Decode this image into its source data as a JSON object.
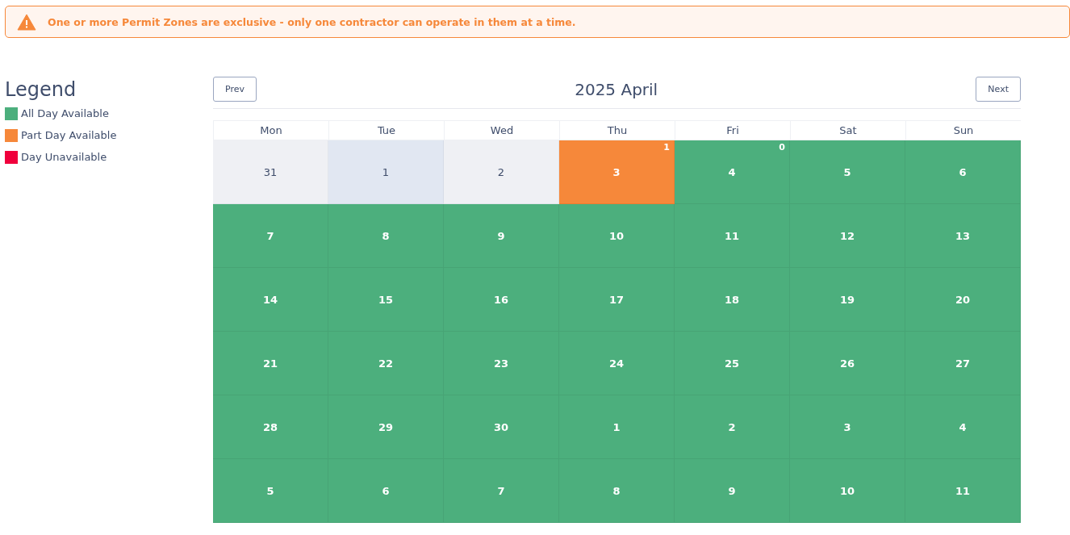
{
  "alert": {
    "text": "One or more Permit Zones are exclusive - only one contractor can operate in them at a time."
  },
  "legend": {
    "title": "Legend",
    "items": [
      {
        "label": "All Day Available",
        "color": "#4caf7d"
      },
      {
        "label": "Part Day Available",
        "color": "#f6883a"
      },
      {
        "label": "Day Unavailable",
        "color": "#f0003c"
      }
    ]
  },
  "calendar": {
    "title": "2025 April",
    "prev": "Prev",
    "next": "Next",
    "weekdays": [
      "Mon",
      "Tue",
      "Wed",
      "Thu",
      "Fri",
      "Sat",
      "Sun"
    ],
    "weeks": [
      [
        {
          "day": "31",
          "kind": "past"
        },
        {
          "day": "1",
          "kind": "today"
        },
        {
          "day": "2",
          "kind": "past"
        },
        {
          "day": "3",
          "kind": "part",
          "count": "1"
        },
        {
          "day": "4",
          "kind": "all",
          "count": "0"
        },
        {
          "day": "5",
          "kind": "all"
        },
        {
          "day": "6",
          "kind": "all"
        }
      ],
      [
        {
          "day": "7",
          "kind": "all"
        },
        {
          "day": "8",
          "kind": "all"
        },
        {
          "day": "9",
          "kind": "all"
        },
        {
          "day": "10",
          "kind": "all"
        },
        {
          "day": "11",
          "kind": "all"
        },
        {
          "day": "12",
          "kind": "all"
        },
        {
          "day": "13",
          "kind": "all"
        }
      ],
      [
        {
          "day": "14",
          "kind": "all"
        },
        {
          "day": "15",
          "kind": "all"
        },
        {
          "day": "16",
          "kind": "all"
        },
        {
          "day": "17",
          "kind": "all"
        },
        {
          "day": "18",
          "kind": "all"
        },
        {
          "day": "19",
          "kind": "all"
        },
        {
          "day": "20",
          "kind": "all"
        }
      ],
      [
        {
          "day": "21",
          "kind": "all"
        },
        {
          "day": "22",
          "kind": "all"
        },
        {
          "day": "23",
          "kind": "all"
        },
        {
          "day": "24",
          "kind": "all"
        },
        {
          "day": "25",
          "kind": "all"
        },
        {
          "day": "26",
          "kind": "all"
        },
        {
          "day": "27",
          "kind": "all"
        }
      ],
      [
        {
          "day": "28",
          "kind": "all"
        },
        {
          "day": "29",
          "kind": "all"
        },
        {
          "day": "30",
          "kind": "all"
        },
        {
          "day": "1",
          "kind": "all"
        },
        {
          "day": "2",
          "kind": "all"
        },
        {
          "day": "3",
          "kind": "all"
        },
        {
          "day": "4",
          "kind": "all"
        }
      ],
      [
        {
          "day": "5",
          "kind": "all"
        },
        {
          "day": "6",
          "kind": "all"
        },
        {
          "day": "7",
          "kind": "all"
        },
        {
          "day": "8",
          "kind": "all"
        },
        {
          "day": "9",
          "kind": "all"
        },
        {
          "day": "10",
          "kind": "all"
        },
        {
          "day": "11",
          "kind": "all"
        }
      ]
    ]
  }
}
